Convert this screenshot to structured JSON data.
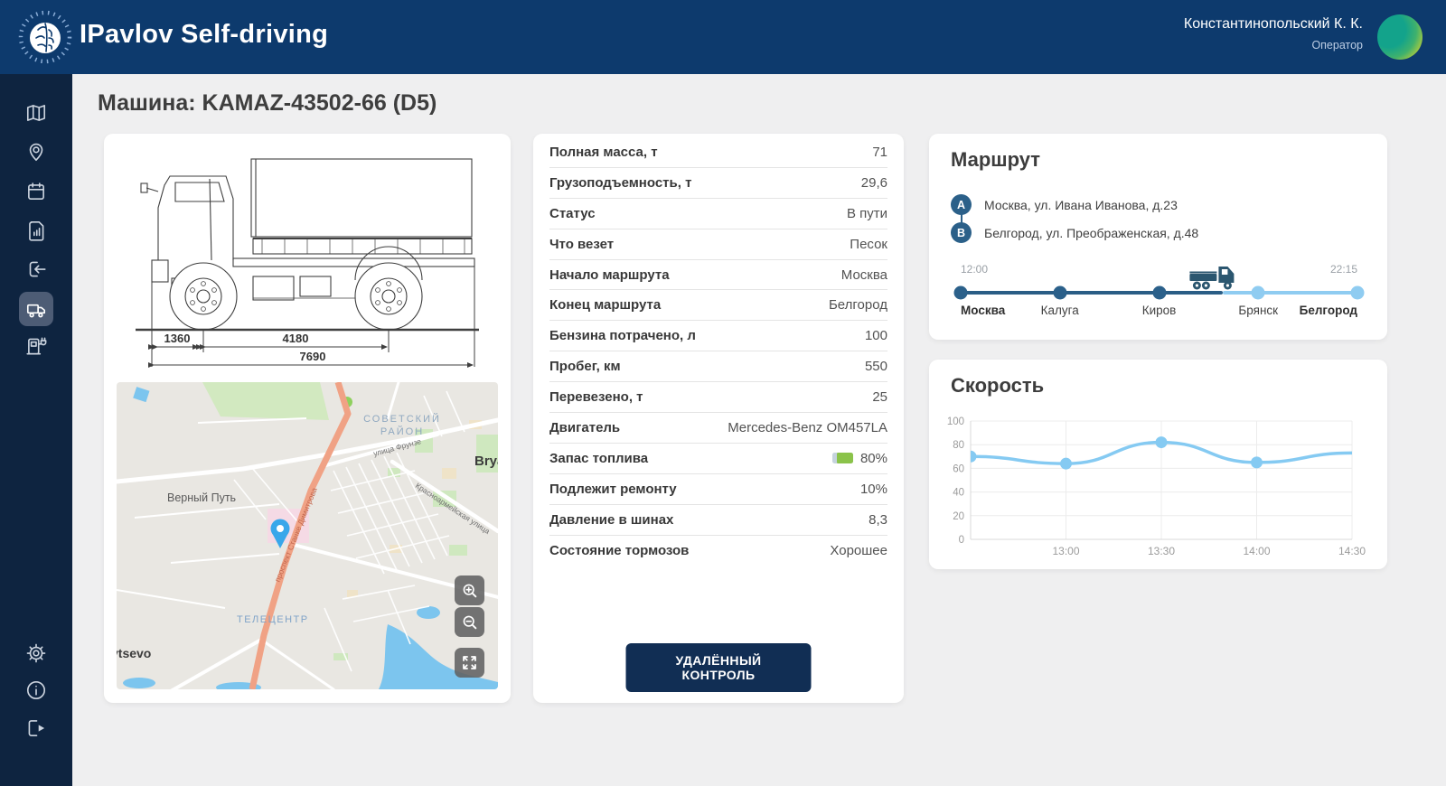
{
  "header": {
    "app_title": "IPavlov Self-driving",
    "user": {
      "name": "Константинопольский К. К.",
      "role": "Оператор"
    }
  },
  "sidebar": {
    "items": [
      {
        "icon": "map",
        "active": false
      },
      {
        "icon": "location-pin",
        "active": false
      },
      {
        "icon": "calendar",
        "active": false
      },
      {
        "icon": "report-file",
        "active": false
      },
      {
        "icon": "login",
        "active": false
      },
      {
        "icon": "truck",
        "active": true
      },
      {
        "icon": "charging-station",
        "active": false
      }
    ],
    "bottom_items": [
      {
        "icon": "settings-gear"
      },
      {
        "icon": "info"
      },
      {
        "icon": "logout"
      }
    ]
  },
  "page": {
    "title": "Машина: KAMAZ-43502-66 (D5)"
  },
  "vehicle_card": {
    "drawing_dimensions": [
      "1360",
      "4180",
      "7690"
    ],
    "map": {
      "labels": {
        "district_line1": "СОВЕТСКИЙ",
        "district_line2": "РАЙОН",
        "settlement": "Верный Путь",
        "area": "ТЕЛЕЦЕНТР",
        "partial_right": "Brya",
        "partial_left": "vtsevo",
        "street1": "улица Фрунзе",
        "street2": "Красноармейская улица",
        "street3": "проспект Станке Димитрова"
      },
      "controls": [
        "zoom-in",
        "zoom-out",
        "fullscreen"
      ]
    }
  },
  "specs": {
    "rows": [
      {
        "label": "Полная масса, т",
        "value": "71"
      },
      {
        "label": "Грузоподъемность, т",
        "value": "29,6"
      },
      {
        "label": "Статус",
        "value": "В пути"
      },
      {
        "label": "Что везет",
        "value": "Песок"
      },
      {
        "label": "Начало маршрута",
        "value": "Москва"
      },
      {
        "label": "Конец маршрута",
        "value": "Белгород"
      },
      {
        "label": "Бензина потрачено, л",
        "value": "100"
      },
      {
        "label": "Пробег, км",
        "value": "550"
      },
      {
        "label": "Перевезено, т",
        "value": "25"
      },
      {
        "label": "Двигатель",
        "value": "Mercedes-Benz OM457LA"
      },
      {
        "label": "Запас топлива",
        "value": "80%",
        "icon": "fuel-battery",
        "icon_fill_percent": 80,
        "icon_color": "#8bc34a"
      },
      {
        "label": "Подлежит ремонту",
        "value": "10%"
      },
      {
        "label": "Давление в шинах",
        "value": "8,3"
      },
      {
        "label": "Состояние тормозов",
        "value": "Хорошее"
      }
    ],
    "action_button": "УДАЛЁННЫЙ КОНТРОЛЬ"
  },
  "route": {
    "title": "Маршрут",
    "points": [
      {
        "marker": "A",
        "address": "Москва, ул. Ивана Иванова, д.23"
      },
      {
        "marker": "B",
        "address": "Белгород, ул. Преображенская, д.48"
      }
    ],
    "timeline": {
      "start_time": "12:00",
      "end_time": "22:15",
      "progress_percent": 64,
      "stops": [
        {
          "name": "Москва",
          "reached": true,
          "bold": true
        },
        {
          "name": "Калуга",
          "reached": true,
          "bold": false
        },
        {
          "name": "Киров",
          "reached": true,
          "bold": false
        },
        {
          "name": "Брянск",
          "reached": false,
          "bold": false
        },
        {
          "name": "Белгород",
          "reached": false,
          "bold": true
        }
      ]
    }
  },
  "speed_card": {
    "title": "Скорость"
  },
  "chart_data": {
    "type": "line",
    "title": "Скорость",
    "xlabel": "",
    "ylabel": "",
    "x_tick_labels": [
      "",
      "13:00",
      "13:30",
      "14:00",
      "14:30"
    ],
    "values": [
      70,
      64,
      82,
      65,
      73
    ],
    "ylim": [
      0,
      100
    ],
    "yticks": [
      0,
      20,
      40,
      60,
      80,
      100
    ],
    "grid": true,
    "legend": "none",
    "line_color": "#85caf2",
    "marker_indices": [
      0,
      1,
      2,
      3
    ]
  },
  "colors": {
    "header_bg": "#0d3a6d",
    "sidebar_bg": "#0e2440",
    "active_item_bg": "#4d5c75",
    "button_bg": "#112e54",
    "route_dark": "#2a5d85",
    "route_light": "#8fccf1",
    "fuel_green": "#8bc34a",
    "map_road_orange": "#f0a285",
    "map_water_blue": "#7cc5ee"
  }
}
